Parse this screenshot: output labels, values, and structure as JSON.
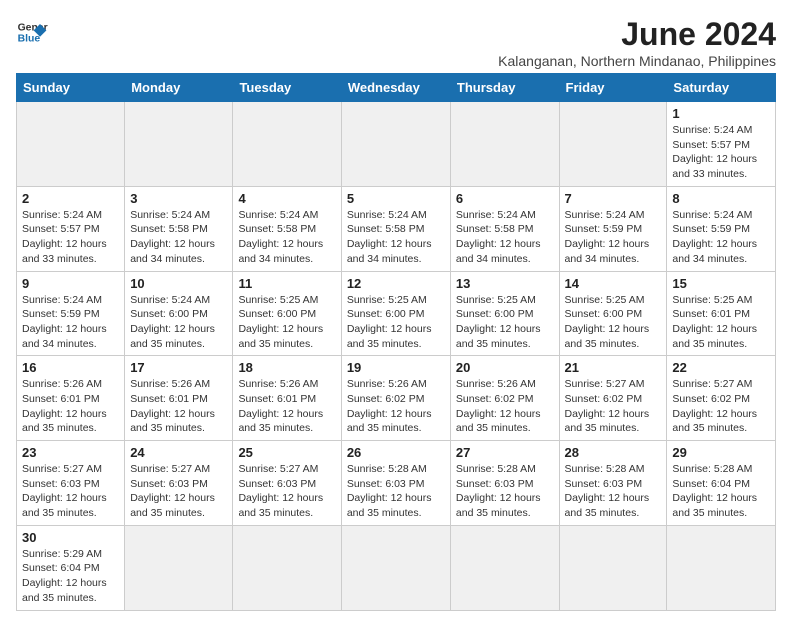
{
  "header": {
    "logo_line1": "General",
    "logo_line2": "Blue",
    "month_year": "June 2024",
    "location": "Kalanganan, Northern Mindanao, Philippines"
  },
  "days_of_week": [
    "Sunday",
    "Monday",
    "Tuesday",
    "Wednesday",
    "Thursday",
    "Friday",
    "Saturday"
  ],
  "weeks": [
    [
      {
        "day": "",
        "info": ""
      },
      {
        "day": "",
        "info": ""
      },
      {
        "day": "",
        "info": ""
      },
      {
        "day": "",
        "info": ""
      },
      {
        "day": "",
        "info": ""
      },
      {
        "day": "",
        "info": ""
      },
      {
        "day": "1",
        "info": "Sunrise: 5:24 AM\nSunset: 5:57 PM\nDaylight: 12 hours\nand 33 minutes."
      }
    ],
    [
      {
        "day": "2",
        "info": "Sunrise: 5:24 AM\nSunset: 5:57 PM\nDaylight: 12 hours\nand 33 minutes."
      },
      {
        "day": "3",
        "info": "Sunrise: 5:24 AM\nSunset: 5:58 PM\nDaylight: 12 hours\nand 34 minutes."
      },
      {
        "day": "4",
        "info": "Sunrise: 5:24 AM\nSunset: 5:58 PM\nDaylight: 12 hours\nand 34 minutes."
      },
      {
        "day": "5",
        "info": "Sunrise: 5:24 AM\nSunset: 5:58 PM\nDaylight: 12 hours\nand 34 minutes."
      },
      {
        "day": "6",
        "info": "Sunrise: 5:24 AM\nSunset: 5:58 PM\nDaylight: 12 hours\nand 34 minutes."
      },
      {
        "day": "7",
        "info": "Sunrise: 5:24 AM\nSunset: 5:59 PM\nDaylight: 12 hours\nand 34 minutes."
      },
      {
        "day": "8",
        "info": "Sunrise: 5:24 AM\nSunset: 5:59 PM\nDaylight: 12 hours\nand 34 minutes."
      }
    ],
    [
      {
        "day": "9",
        "info": "Sunrise: 5:24 AM\nSunset: 5:59 PM\nDaylight: 12 hours\nand 34 minutes."
      },
      {
        "day": "10",
        "info": "Sunrise: 5:24 AM\nSunset: 6:00 PM\nDaylight: 12 hours\nand 35 minutes."
      },
      {
        "day": "11",
        "info": "Sunrise: 5:25 AM\nSunset: 6:00 PM\nDaylight: 12 hours\nand 35 minutes."
      },
      {
        "day": "12",
        "info": "Sunrise: 5:25 AM\nSunset: 6:00 PM\nDaylight: 12 hours\nand 35 minutes."
      },
      {
        "day": "13",
        "info": "Sunrise: 5:25 AM\nSunset: 6:00 PM\nDaylight: 12 hours\nand 35 minutes."
      },
      {
        "day": "14",
        "info": "Sunrise: 5:25 AM\nSunset: 6:00 PM\nDaylight: 12 hours\nand 35 minutes."
      },
      {
        "day": "15",
        "info": "Sunrise: 5:25 AM\nSunset: 6:01 PM\nDaylight: 12 hours\nand 35 minutes."
      }
    ],
    [
      {
        "day": "16",
        "info": "Sunrise: 5:26 AM\nSunset: 6:01 PM\nDaylight: 12 hours\nand 35 minutes."
      },
      {
        "day": "17",
        "info": "Sunrise: 5:26 AM\nSunset: 6:01 PM\nDaylight: 12 hours\nand 35 minutes."
      },
      {
        "day": "18",
        "info": "Sunrise: 5:26 AM\nSunset: 6:01 PM\nDaylight: 12 hours\nand 35 minutes."
      },
      {
        "day": "19",
        "info": "Sunrise: 5:26 AM\nSunset: 6:02 PM\nDaylight: 12 hours\nand 35 minutes."
      },
      {
        "day": "20",
        "info": "Sunrise: 5:26 AM\nSunset: 6:02 PM\nDaylight: 12 hours\nand 35 minutes."
      },
      {
        "day": "21",
        "info": "Sunrise: 5:27 AM\nSunset: 6:02 PM\nDaylight: 12 hours\nand 35 minutes."
      },
      {
        "day": "22",
        "info": "Sunrise: 5:27 AM\nSunset: 6:02 PM\nDaylight: 12 hours\nand 35 minutes."
      }
    ],
    [
      {
        "day": "23",
        "info": "Sunrise: 5:27 AM\nSunset: 6:03 PM\nDaylight: 12 hours\nand 35 minutes."
      },
      {
        "day": "24",
        "info": "Sunrise: 5:27 AM\nSunset: 6:03 PM\nDaylight: 12 hours\nand 35 minutes."
      },
      {
        "day": "25",
        "info": "Sunrise: 5:27 AM\nSunset: 6:03 PM\nDaylight: 12 hours\nand 35 minutes."
      },
      {
        "day": "26",
        "info": "Sunrise: 5:28 AM\nSunset: 6:03 PM\nDaylight: 12 hours\nand 35 minutes."
      },
      {
        "day": "27",
        "info": "Sunrise: 5:28 AM\nSunset: 6:03 PM\nDaylight: 12 hours\nand 35 minutes."
      },
      {
        "day": "28",
        "info": "Sunrise: 5:28 AM\nSunset: 6:03 PM\nDaylight: 12 hours\nand 35 minutes."
      },
      {
        "day": "29",
        "info": "Sunrise: 5:28 AM\nSunset: 6:04 PM\nDaylight: 12 hours\nand 35 minutes."
      }
    ],
    [
      {
        "day": "30",
        "info": "Sunrise: 5:29 AM\nSunset: 6:04 PM\nDaylight: 12 hours\nand 35 minutes."
      },
      {
        "day": "",
        "info": ""
      },
      {
        "day": "",
        "info": ""
      },
      {
        "day": "",
        "info": ""
      },
      {
        "day": "",
        "info": ""
      },
      {
        "day": "",
        "info": ""
      },
      {
        "day": "",
        "info": ""
      }
    ]
  ]
}
